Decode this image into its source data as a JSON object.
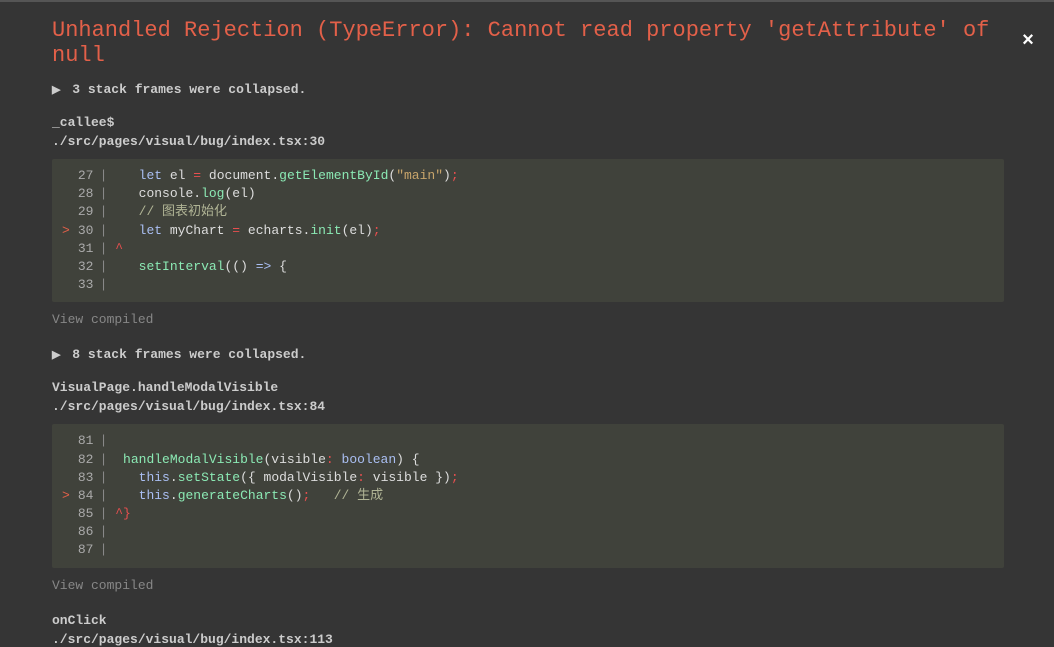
{
  "title": "Unhandled Rejection (TypeError): Cannot read property 'getAttribute' of null",
  "collapsed1": "3 stack frames were collapsed.",
  "frame1": {
    "fn": "_callee$",
    "path": "./src/pages/visual/bug/index.tsx:30"
  },
  "code1": {
    "l27_n": "27",
    "l28_n": "28",
    "l29_n": "29",
    "l30_n": "30",
    "l31_n": "31",
    "l32_n": "32",
    "l33_n": "33",
    "kw_let": "let",
    "el": "el",
    "eq": "=",
    "document": "document",
    "getElementById": "getElementById",
    "main_str": "\"main\"",
    "console": "console",
    "log": "log",
    "comment1": "// 图表初始化",
    "mychart": "myChart",
    "echarts": "echarts",
    "init": "init",
    "caret": "^",
    "setInterval": "setInterval",
    "arrow": "=>",
    "brace": "{"
  },
  "view_compiled": "View compiled",
  "collapsed2": "8 stack frames were collapsed.",
  "frame2": {
    "fn": "VisualPage.handleModalVisible",
    "path": "./src/pages/visual/bug/index.tsx:84"
  },
  "code2": {
    "l81_n": "81",
    "l82_n": "82",
    "l83_n": "83",
    "l84_n": "84",
    "l85_n": "85",
    "l86_n": "86",
    "l87_n": "87",
    "handleModalVisible": "handleModalVisible",
    "visible": "visible",
    "colon": ":",
    "boolean": "boolean",
    "this": "this",
    "setState": "setState",
    "modalVisible": "modalVisible",
    "generateCharts": "generateCharts",
    "comment2": "// 生成",
    "caret_brace": "^}"
  },
  "frame3": {
    "fn": "onClick",
    "path": "./src/pages/visual/bug/index.tsx:113"
  }
}
